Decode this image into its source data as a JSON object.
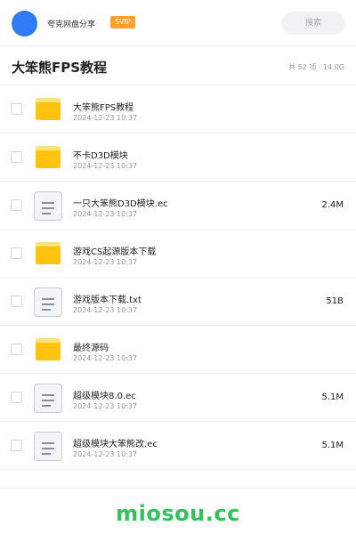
{
  "header": {
    "user_name": "夸克网盘分享",
    "badge": "SVIP",
    "search_label": "搜索"
  },
  "title_bar": {
    "title": "大笨熊FPS教程",
    "meta": "共 52 项 · 14.0G"
  },
  "files": [
    {
      "name": "大笨熊FPS教程",
      "date": "2024-12-23 10:37",
      "size": "",
      "type": "folder"
    },
    {
      "name": "不卡D3D模块",
      "date": "2024-12-23 10:37",
      "size": "",
      "type": "folder"
    },
    {
      "name": "一只大笨熊D3D模块.ec",
      "date": "2024-12-23 10:37",
      "size": "2.4M",
      "type": "file"
    },
    {
      "name": "游戏CS起源版本下载",
      "date": "2024-12-23 10:37",
      "size": "",
      "type": "folder"
    },
    {
      "name": "游戏版本下载.txt",
      "date": "2024-12-23 10:37",
      "size": "51B",
      "type": "file"
    },
    {
      "name": "最终源码",
      "date": "2024-12-23 10:37",
      "size": "",
      "type": "folder"
    },
    {
      "name": "超级模块8.0.ec",
      "date": "2024-12-23 10:37",
      "size": "5.1M",
      "type": "file"
    },
    {
      "name": "超级模块大笨熊改.ec",
      "date": "2024-12-23 10:37",
      "size": "5.1M",
      "type": "file"
    }
  ],
  "footer": {
    "watermark": "miosou.cc"
  },
  "colors": {
    "accent_blue": "#2f7cf6",
    "svip_orange": "#ff9f2e",
    "folder_yellow": "#ffc20e",
    "watermark_green": "#33c25a"
  }
}
